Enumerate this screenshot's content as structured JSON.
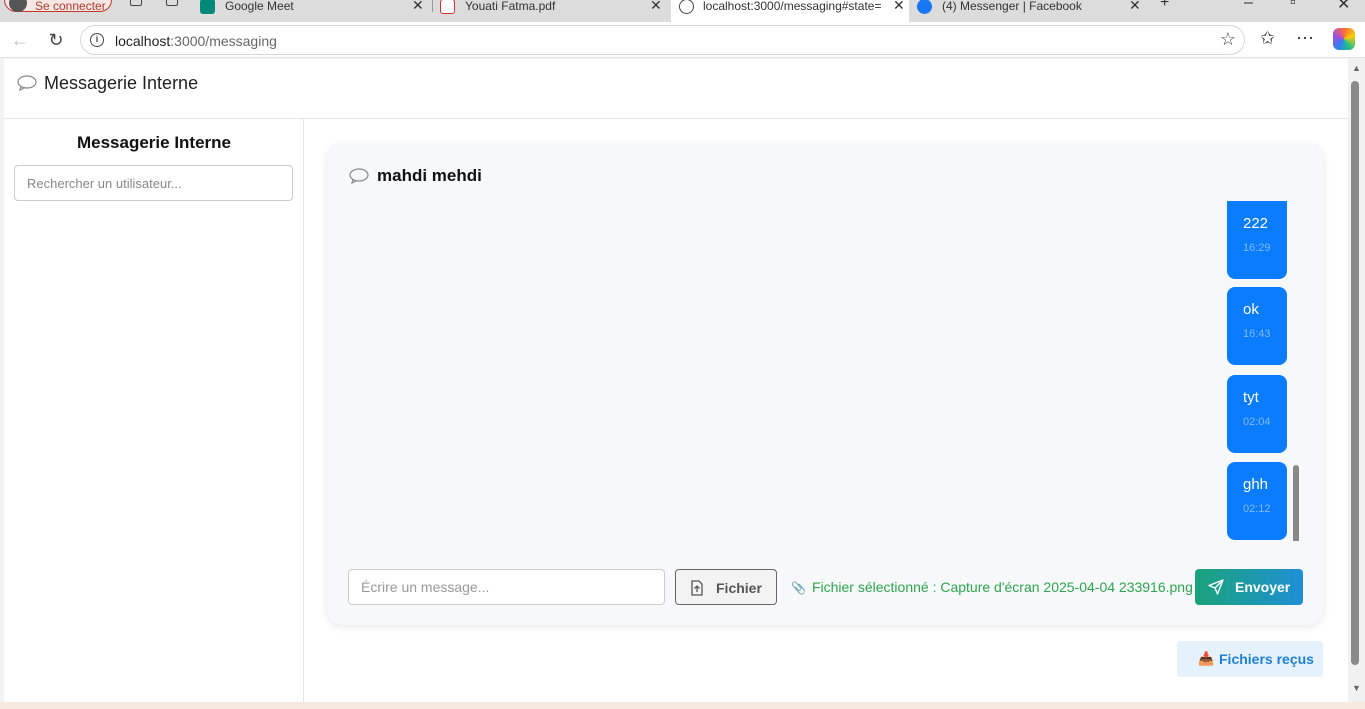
{
  "browser": {
    "profile_label": "Se connecter",
    "tabs": [
      {
        "title": "Google Meet",
        "icon": "google-meet-icon"
      },
      {
        "title": "Youati Fatma.pdf",
        "icon": "pdf-icon"
      },
      {
        "title": "localhost:3000/messaging#state=",
        "icon": "globe-icon"
      },
      {
        "title": "(4) Messenger | Facebook",
        "icon": "facebook-icon"
      }
    ],
    "url_host": "localhost",
    "url_path": ":3000/messaging"
  },
  "app": {
    "header_title": "Messagerie Interne"
  },
  "sidebar": {
    "title": "Messagerie Interne",
    "search_placeholder": "Rechercher un utilisateur..."
  },
  "chat": {
    "contact_name": "mahdi mehdi",
    "messages": [
      {
        "text": "222",
        "time": "16:29"
      },
      {
        "text": "ok",
        "time": "16:43"
      },
      {
        "text": "tyt",
        "time": "02:04"
      },
      {
        "text": "ghh",
        "time": "02:12"
      }
    ],
    "input_placeholder": "Écrire un message...",
    "file_button_label": "Fichier",
    "selected_file_text": "Fichier sélectionné : Capture d'écran 2025-04-04 233916.png",
    "send_button_label": "Envoyer",
    "received_files_label": "Fichiers reçus"
  },
  "colors": {
    "message_bubble": "#0a7cff",
    "send_gradient_start": "#1aa37a",
    "send_gradient_end": "#1f8fd6",
    "file_selected_text": "#2ea44f",
    "received_button_text": "#1f7fd6"
  }
}
